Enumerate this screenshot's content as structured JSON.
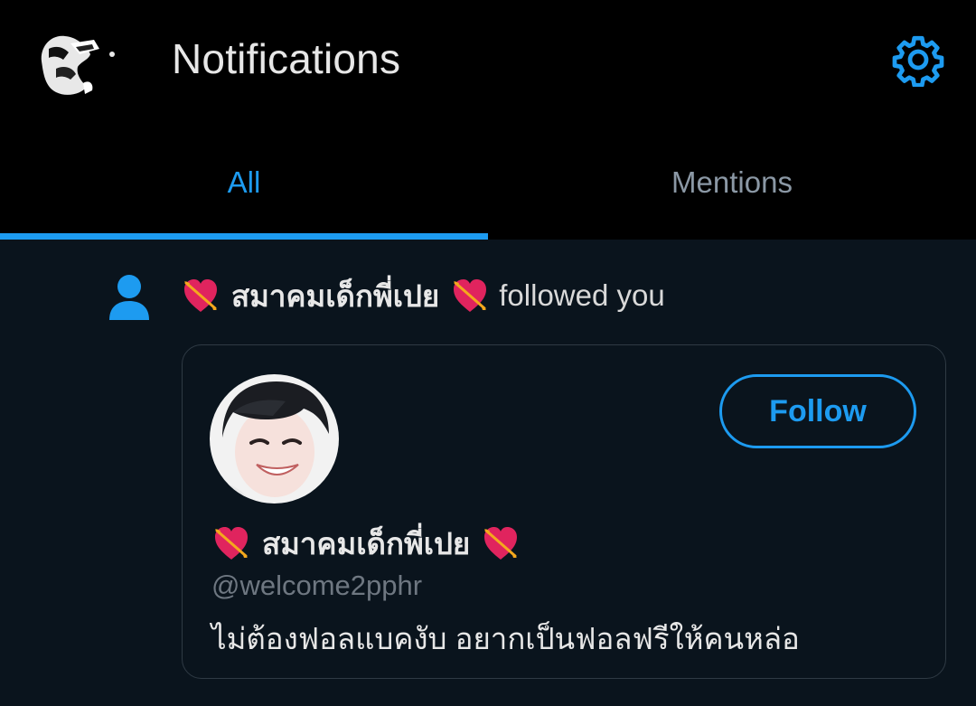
{
  "header": {
    "title": "Notifications",
    "settings_icon": "gear-icon",
    "accent_color": "#1d9bf0"
  },
  "tabs": [
    {
      "label": "All",
      "active": true
    },
    {
      "label": "Mentions",
      "active": false
    }
  ],
  "notification": {
    "icon": "person-icon",
    "name": "สมาคมเด็กพี่เปย",
    "action": "followed you",
    "emoji": "heart-with-arrow-icon"
  },
  "profile_card": {
    "name": "สมาคมเด็กพี่เปย",
    "handle": "@welcome2pphr",
    "bio": "ไม่ต้องฟอลแบคงับ อยากเป็นฟอลฟรีให้คนหล่อ",
    "follow_label": "Follow"
  }
}
